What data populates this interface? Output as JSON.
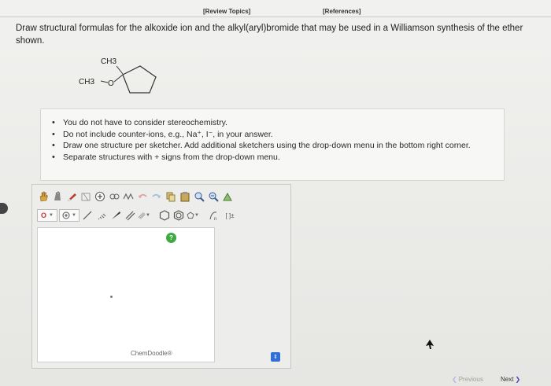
{
  "header": {
    "review_topics": "[Review Topics]",
    "references": "[References]"
  },
  "question": {
    "text": "Draw structural formulas for the alkoxide ion and the alkyl(aryl)bromide that may be used in a Williamson synthesis of the ether shown."
  },
  "molecule": {
    "ch3_top": "CH3",
    "ch3_left": "CH3",
    "oxygen": "O"
  },
  "instructions": [
    "You do not have to consider stereochemistry.",
    "Do not include counter-ions, e.g., Na⁺, I⁻, in your answer.",
    "Draw one structure per sketcher. Add additional sketchers using the drop-down menu in the bottom right corner.",
    "Separate structures with + signs from the drop-down menu."
  ],
  "sketcher": {
    "element_label": "O",
    "brand": "ChemDoodle®",
    "help": "?",
    "bracket_label": "[ ]±"
  },
  "nav": {
    "previous": "Previous",
    "next": "Next"
  },
  "colors": {
    "help_green": "#3faa3f",
    "select_blue": "#2f6fd6"
  }
}
